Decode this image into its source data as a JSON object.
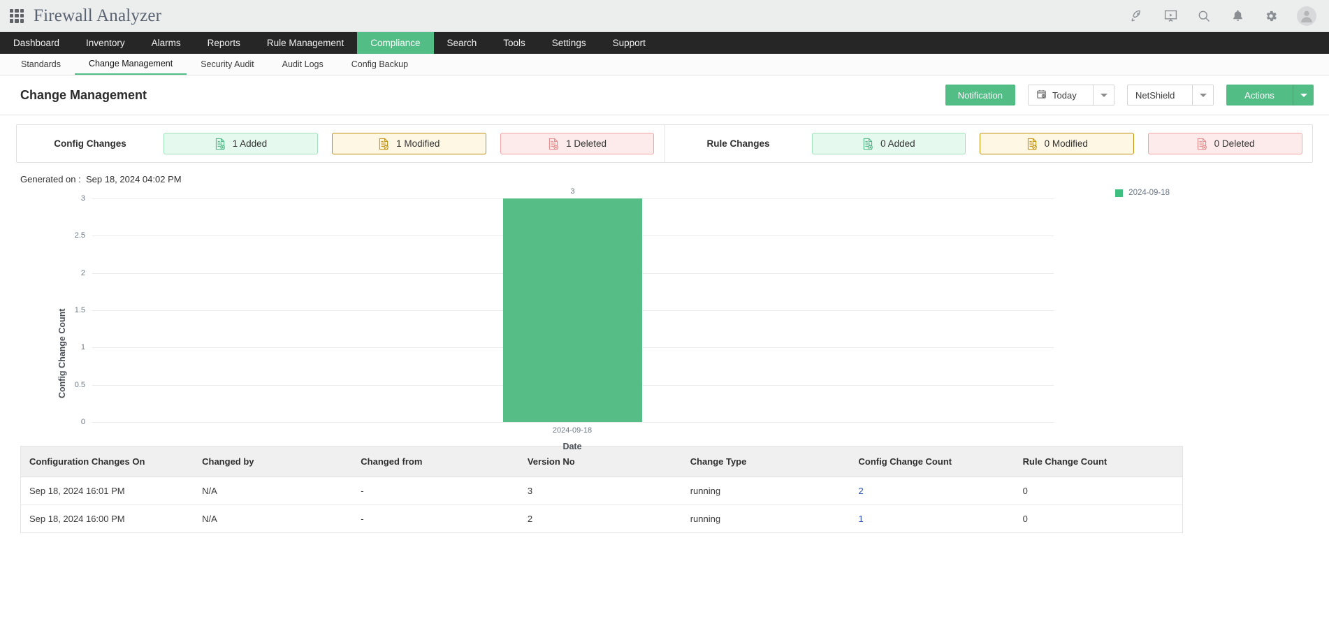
{
  "app": {
    "title": "Firewall Analyzer",
    "top_icons": [
      "grid-menu-icon",
      "rocket-icon",
      "presentation-icon",
      "search-icon",
      "bell-icon",
      "gear-icon",
      "avatar-icon"
    ]
  },
  "mainnav": {
    "items": [
      {
        "label": "Dashboard",
        "active": false
      },
      {
        "label": "Inventory",
        "active": false
      },
      {
        "label": "Alarms",
        "active": false
      },
      {
        "label": "Reports",
        "active": false
      },
      {
        "label": "Rule Management",
        "active": false
      },
      {
        "label": "Compliance",
        "active": true
      },
      {
        "label": "Search",
        "active": false
      },
      {
        "label": "Tools",
        "active": false
      },
      {
        "label": "Settings",
        "active": false
      },
      {
        "label": "Support",
        "active": false
      }
    ]
  },
  "subnav": {
    "items": [
      {
        "label": "Standards",
        "active": false
      },
      {
        "label": "Change Management",
        "active": true
      },
      {
        "label": "Security Audit",
        "active": false
      },
      {
        "label": "Audit Logs",
        "active": false
      },
      {
        "label": "Config Backup",
        "active": false
      }
    ]
  },
  "header": {
    "page_title": "Change Management",
    "notification_label": "Notification",
    "date_filter": "Today",
    "device_filter": "NetShield",
    "actions_label": "Actions"
  },
  "stats": {
    "config": {
      "label": "Config Changes",
      "added": "1 Added",
      "modified": "1 Modified",
      "deleted": "1 Deleted"
    },
    "rule": {
      "label": "Rule Changes",
      "added": "0 Added",
      "modified": "0 Modified",
      "deleted": "0 Deleted"
    }
  },
  "generated": {
    "label": "Generated on :",
    "value": "Sep 18, 2024 04:02 PM"
  },
  "chart_data": {
    "type": "bar",
    "title": "",
    "categories": [
      "2024-09-18"
    ],
    "values": [
      3
    ],
    "xlabel": "Date",
    "ylabel": "Config Change Count",
    "ylim": [
      0,
      3
    ],
    "yticks": [
      "3",
      "2.5",
      "2",
      "1.5",
      "1",
      "0.5",
      "0"
    ],
    "data_labels": [
      "3"
    ],
    "legend": [
      {
        "name": "2024-09-18",
        "color": "#3fbf7f"
      }
    ],
    "legend_position": "top-right",
    "grid": true,
    "bar_color": "#55bd85"
  },
  "table": {
    "columns": [
      "Configuration Changes On",
      "Changed by",
      "Changed from",
      "Version No",
      "Change Type",
      "Config Change Count",
      "Rule Change Count"
    ],
    "rows": [
      {
        "changes_on": "Sep 18, 2024 16:01 PM",
        "changed_by": "N/A",
        "changed_from": "-",
        "version_no": "3",
        "change_type": "running",
        "config_change_count": "2",
        "rule_change_count": "0"
      },
      {
        "changes_on": "Sep 18, 2024 16:00 PM",
        "changed_by": "N/A",
        "changed_from": "-",
        "version_no": "2",
        "change_type": "running",
        "config_change_count": "1",
        "rule_change_count": "0"
      }
    ]
  },
  "colors": {
    "brand_green": "#53bd86",
    "nav_dark": "#262626",
    "added": "#9fe0bd",
    "modified": "#c08d0d",
    "deleted": "#f3a3a3",
    "link": "#2c4fb0"
  }
}
